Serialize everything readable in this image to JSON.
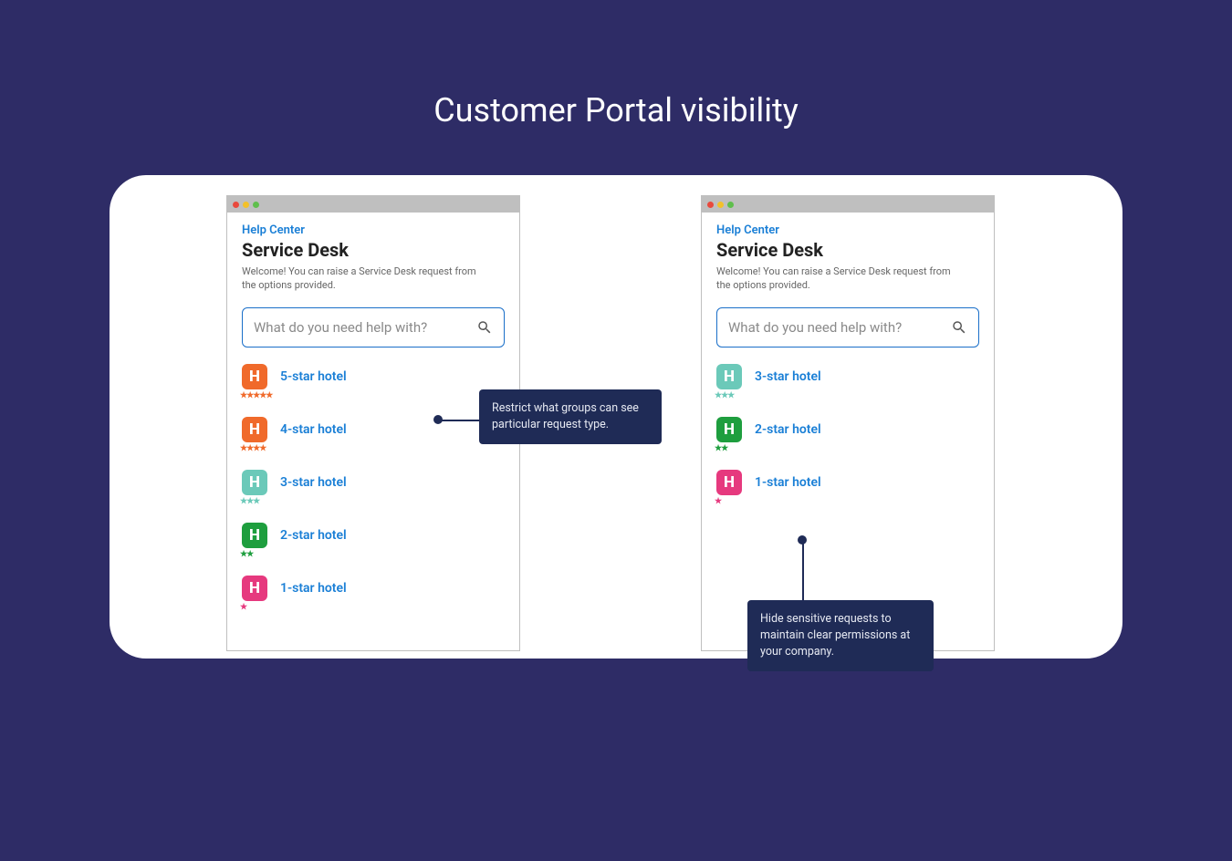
{
  "title": "Customer Portal visibility",
  "helpCenterLabel": "Help Center",
  "serviceDeskHeading": "Service Desk",
  "welcomeText": "Welcome! You can raise a Service Desk request from the options provided.",
  "searchPlaceholder": "What do you need help with?",
  "leftPanel": {
    "items": [
      {
        "label": "5-star hotel",
        "color": "orange",
        "stars": 5
      },
      {
        "label": "4-star hotel",
        "color": "orange",
        "stars": 4
      },
      {
        "label": "3-star hotel",
        "color": "teal",
        "stars": 3
      },
      {
        "label": "2-star hotel",
        "color": "green",
        "stars": 2
      },
      {
        "label": "1-star hotel",
        "color": "pink",
        "stars": 1
      }
    ],
    "callout": "Restrict what groups can see particular request type."
  },
  "rightPanel": {
    "items": [
      {
        "label": "3-star hotel",
        "color": "teal",
        "stars": 3
      },
      {
        "label": "2-star hotel",
        "color": "green",
        "stars": 2
      },
      {
        "label": "1-star hotel",
        "color": "pink",
        "stars": 1
      }
    ],
    "callout": "Hide sensitive requests to maintain clear permissions at your company."
  }
}
